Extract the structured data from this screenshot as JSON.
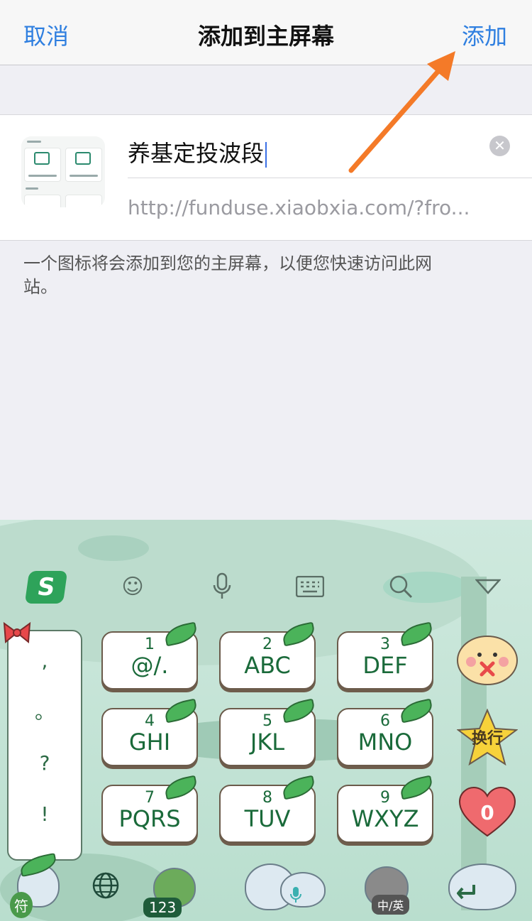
{
  "navbar": {
    "cancel": "取消",
    "title": "添加到主屏幕",
    "add": "添加"
  },
  "bookmark": {
    "name": "养基定投波段",
    "url": "http://funduse.xiaobxia.com/?fro..."
  },
  "hint": "一个图标将会添加到您的主屏幕，以便您快速访问此网站。",
  "keyboard": {
    "punct": [
      ",",
      "。",
      "?",
      "!"
    ],
    "keys": [
      {
        "num": "1",
        "letters": "@/."
      },
      {
        "num": "2",
        "letters": "ABC"
      },
      {
        "num": "3",
        "letters": "DEF"
      },
      {
        "num": "4",
        "letters": "GHI"
      },
      {
        "num": "5",
        "letters": "JKL"
      },
      {
        "num": "6",
        "letters": "MNO"
      },
      {
        "num": "7",
        "letters": "PQRS"
      },
      {
        "num": "8",
        "letters": "TUV"
      },
      {
        "num": "9",
        "letters": "WXYZ"
      }
    ],
    "logo": "S",
    "enter_label": "换行",
    "zero_label": "0",
    "symbol_label": "符",
    "num_label": "123",
    "lang_label": "中/英"
  },
  "colors": {
    "accent": "#2f7fe0",
    "arrow": "#f47a28",
    "keyboard_green": "#cfe9de"
  }
}
